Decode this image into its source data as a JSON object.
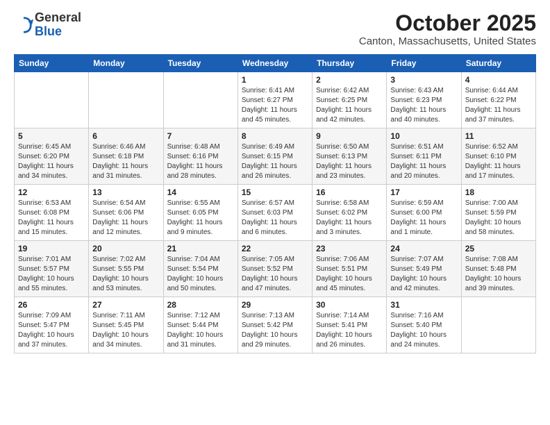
{
  "header": {
    "logo": {
      "general": "General",
      "blue": "Blue"
    },
    "title": "October 2025",
    "subtitle": "Canton, Massachusetts, United States"
  },
  "calendar": {
    "days_of_week": [
      "Sunday",
      "Monday",
      "Tuesday",
      "Wednesday",
      "Thursday",
      "Friday",
      "Saturday"
    ],
    "weeks": [
      [
        {
          "day": "",
          "info": ""
        },
        {
          "day": "",
          "info": ""
        },
        {
          "day": "",
          "info": ""
        },
        {
          "day": "1",
          "info": "Sunrise: 6:41 AM\nSunset: 6:27 PM\nDaylight: 11 hours\nand 45 minutes."
        },
        {
          "day": "2",
          "info": "Sunrise: 6:42 AM\nSunset: 6:25 PM\nDaylight: 11 hours\nand 42 minutes."
        },
        {
          "day": "3",
          "info": "Sunrise: 6:43 AM\nSunset: 6:23 PM\nDaylight: 11 hours\nand 40 minutes."
        },
        {
          "day": "4",
          "info": "Sunrise: 6:44 AM\nSunset: 6:22 PM\nDaylight: 11 hours\nand 37 minutes."
        }
      ],
      [
        {
          "day": "5",
          "info": "Sunrise: 6:45 AM\nSunset: 6:20 PM\nDaylight: 11 hours\nand 34 minutes."
        },
        {
          "day": "6",
          "info": "Sunrise: 6:46 AM\nSunset: 6:18 PM\nDaylight: 11 hours\nand 31 minutes."
        },
        {
          "day": "7",
          "info": "Sunrise: 6:48 AM\nSunset: 6:16 PM\nDaylight: 11 hours\nand 28 minutes."
        },
        {
          "day": "8",
          "info": "Sunrise: 6:49 AM\nSunset: 6:15 PM\nDaylight: 11 hours\nand 26 minutes."
        },
        {
          "day": "9",
          "info": "Sunrise: 6:50 AM\nSunset: 6:13 PM\nDaylight: 11 hours\nand 23 minutes."
        },
        {
          "day": "10",
          "info": "Sunrise: 6:51 AM\nSunset: 6:11 PM\nDaylight: 11 hours\nand 20 minutes."
        },
        {
          "day": "11",
          "info": "Sunrise: 6:52 AM\nSunset: 6:10 PM\nDaylight: 11 hours\nand 17 minutes."
        }
      ],
      [
        {
          "day": "12",
          "info": "Sunrise: 6:53 AM\nSunset: 6:08 PM\nDaylight: 11 hours\nand 15 minutes."
        },
        {
          "day": "13",
          "info": "Sunrise: 6:54 AM\nSunset: 6:06 PM\nDaylight: 11 hours\nand 12 minutes."
        },
        {
          "day": "14",
          "info": "Sunrise: 6:55 AM\nSunset: 6:05 PM\nDaylight: 11 hours\nand 9 minutes."
        },
        {
          "day": "15",
          "info": "Sunrise: 6:57 AM\nSunset: 6:03 PM\nDaylight: 11 hours\nand 6 minutes."
        },
        {
          "day": "16",
          "info": "Sunrise: 6:58 AM\nSunset: 6:02 PM\nDaylight: 11 hours\nand 3 minutes."
        },
        {
          "day": "17",
          "info": "Sunrise: 6:59 AM\nSunset: 6:00 PM\nDaylight: 11 hours\nand 1 minute."
        },
        {
          "day": "18",
          "info": "Sunrise: 7:00 AM\nSunset: 5:59 PM\nDaylight: 10 hours\nand 58 minutes."
        }
      ],
      [
        {
          "day": "19",
          "info": "Sunrise: 7:01 AM\nSunset: 5:57 PM\nDaylight: 10 hours\nand 55 minutes."
        },
        {
          "day": "20",
          "info": "Sunrise: 7:02 AM\nSunset: 5:55 PM\nDaylight: 10 hours\nand 53 minutes."
        },
        {
          "day": "21",
          "info": "Sunrise: 7:04 AM\nSunset: 5:54 PM\nDaylight: 10 hours\nand 50 minutes."
        },
        {
          "day": "22",
          "info": "Sunrise: 7:05 AM\nSunset: 5:52 PM\nDaylight: 10 hours\nand 47 minutes."
        },
        {
          "day": "23",
          "info": "Sunrise: 7:06 AM\nSunset: 5:51 PM\nDaylight: 10 hours\nand 45 minutes."
        },
        {
          "day": "24",
          "info": "Sunrise: 7:07 AM\nSunset: 5:49 PM\nDaylight: 10 hours\nand 42 minutes."
        },
        {
          "day": "25",
          "info": "Sunrise: 7:08 AM\nSunset: 5:48 PM\nDaylight: 10 hours\nand 39 minutes."
        }
      ],
      [
        {
          "day": "26",
          "info": "Sunrise: 7:09 AM\nSunset: 5:47 PM\nDaylight: 10 hours\nand 37 minutes."
        },
        {
          "day": "27",
          "info": "Sunrise: 7:11 AM\nSunset: 5:45 PM\nDaylight: 10 hours\nand 34 minutes."
        },
        {
          "day": "28",
          "info": "Sunrise: 7:12 AM\nSunset: 5:44 PM\nDaylight: 10 hours\nand 31 minutes."
        },
        {
          "day": "29",
          "info": "Sunrise: 7:13 AM\nSunset: 5:42 PM\nDaylight: 10 hours\nand 29 minutes."
        },
        {
          "day": "30",
          "info": "Sunrise: 7:14 AM\nSunset: 5:41 PM\nDaylight: 10 hours\nand 26 minutes."
        },
        {
          "day": "31",
          "info": "Sunrise: 7:16 AM\nSunset: 5:40 PM\nDaylight: 10 hours\nand 24 minutes."
        },
        {
          "day": "",
          "info": ""
        }
      ]
    ]
  }
}
